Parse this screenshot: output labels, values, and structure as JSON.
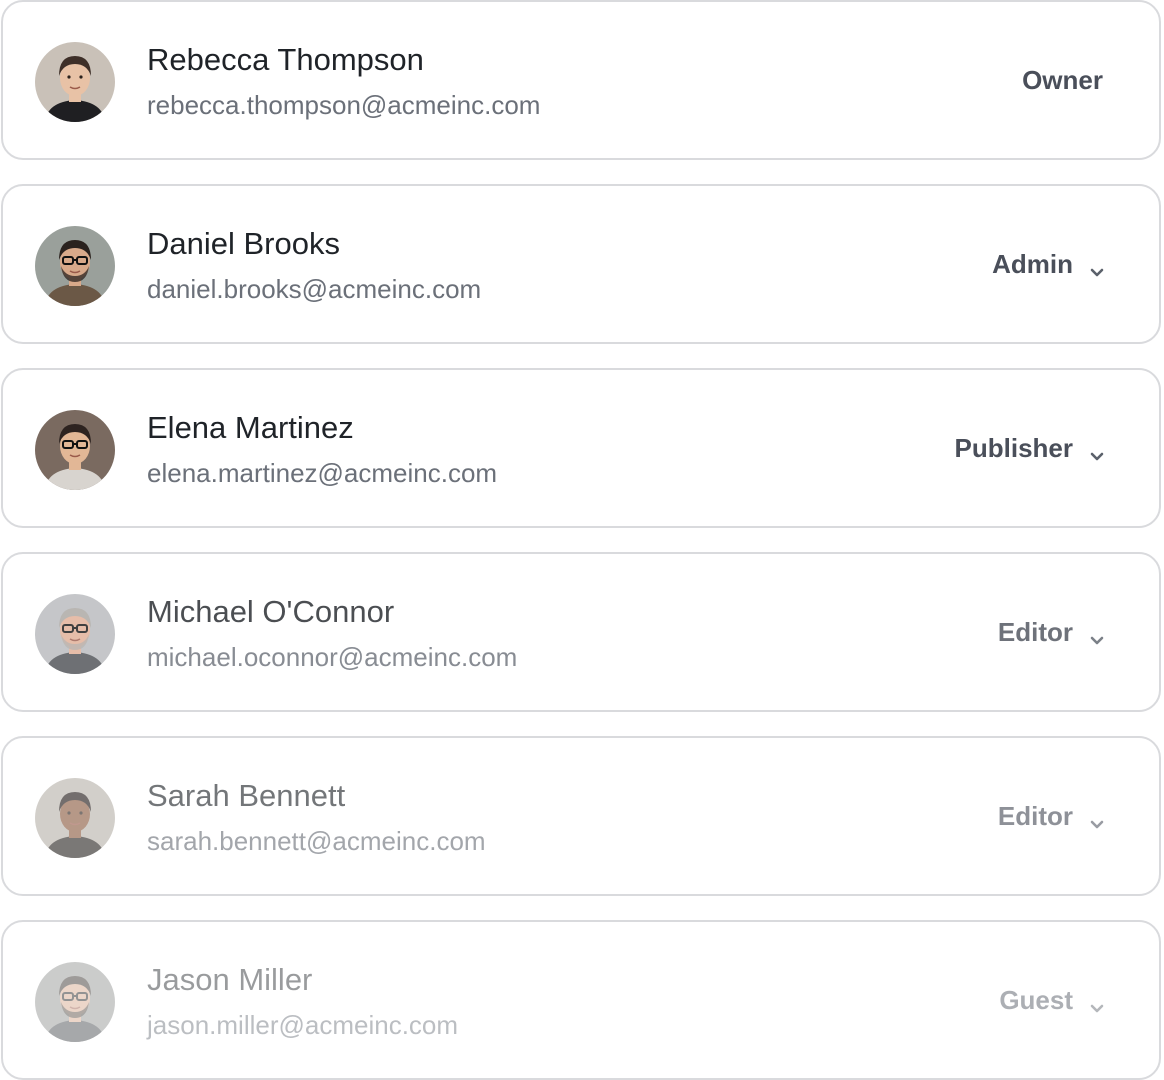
{
  "members": [
    {
      "name": "Rebecca Thompson",
      "email": "rebecca.thompson@acmeinc.com",
      "role": "Owner",
      "role_editable": false,
      "opacity": 1,
      "avatar": {
        "bg": "#c9c1b8",
        "skin": "#e8c2a6",
        "hair": "#3e2f28",
        "shirt": "#1f1f22",
        "glasses": false,
        "beard": false
      }
    },
    {
      "name": "Daniel Brooks",
      "email": "daniel.brooks@acmeinc.com",
      "role": "Admin",
      "role_editable": true,
      "opacity": 1,
      "avatar": {
        "bg": "#9aa09b",
        "skin": "#d8a98a",
        "hair": "#2a221e",
        "shirt": "#6b5846",
        "glasses": true,
        "beard": true
      }
    },
    {
      "name": "Elena Martinez",
      "email": "elena.martinez@acmeinc.com",
      "role": "Publisher",
      "role_editable": true,
      "opacity": 1,
      "avatar": {
        "bg": "#7a6a60",
        "skin": "#e2b796",
        "hair": "#2d2320",
        "shirt": "#d8d4cf",
        "glasses": true,
        "beard": false
      }
    },
    {
      "name": "Michael O'Connor",
      "email": "michael.oconnor@acmeinc.com",
      "role": "Editor",
      "role_editable": true,
      "opacity": 0.8,
      "avatar": {
        "bg": "#b7b9bc",
        "skin": "#e0ad94",
        "hair": "#a8a4a0",
        "shirt": "#4a4d52",
        "glasses": true,
        "beard": true
      }
    },
    {
      "name": "Sarah Bennett",
      "email": "sarah.bennett@acmeinc.com",
      "role": "Editor",
      "role_editable": true,
      "opacity": 0.62,
      "avatar": {
        "bg": "#b8b2aa",
        "skin": "#8a5a3e",
        "hair": "#1e1714",
        "shirt": "#2a2623",
        "glasses": false,
        "beard": false
      }
    },
    {
      "name": "Jason Miller",
      "email": "jason.miller@acmeinc.com",
      "role": "Guest",
      "role_editable": true,
      "opacity": 0.45,
      "avatar": {
        "bg": "#8d8f8e",
        "skin": "#d6a68a",
        "hair": "#2a241f",
        "shirt": "#3c3f44",
        "glasses": true,
        "beard": true
      }
    }
  ],
  "colors": {
    "name": "#1f2328",
    "email": "#6b7079",
    "role": "#4a4f5a",
    "chevron": "#5b616b",
    "border": "#d9dadd"
  }
}
